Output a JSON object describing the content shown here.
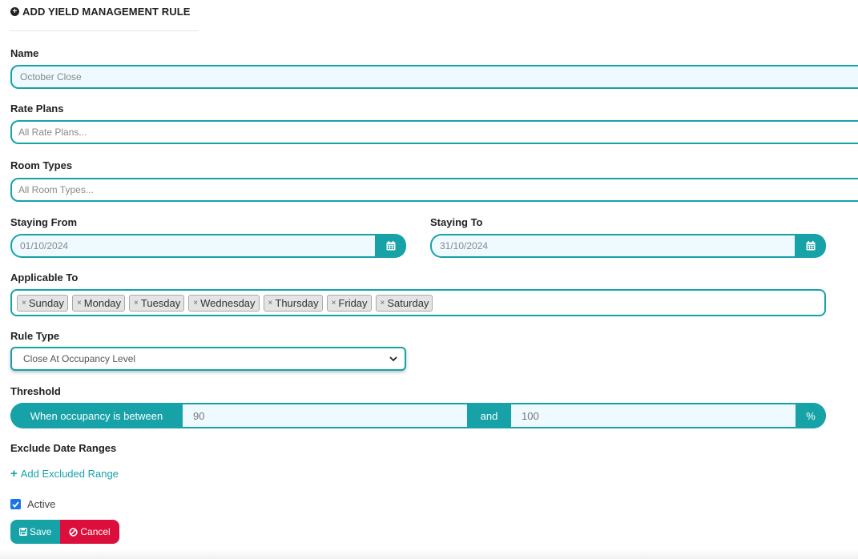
{
  "form": {
    "title": "ADD YIELD MANAGEMENT RULE",
    "title_icon": "plus-circle-icon",
    "name": {
      "label": "Name",
      "value": "October Close"
    },
    "rate_plans": {
      "label": "Rate Plans",
      "placeholder": "All Rate Plans..."
    },
    "room_types": {
      "label": "Room Types",
      "placeholder": "All Room Types..."
    },
    "staying_from": {
      "label": "Staying From",
      "value": "01/10/2024",
      "icon": "calendar-icon"
    },
    "staying_to": {
      "label": "Staying To",
      "value": "31/10/2024",
      "icon": "calendar-icon"
    },
    "applicable_to": {
      "label": "Applicable To",
      "days": [
        "Sunday",
        "Monday",
        "Tuesday",
        "Wednesday",
        "Thursday",
        "Friday",
        "Saturday"
      ],
      "remove_glyph": "×"
    },
    "rule_type": {
      "label": "Rule Type",
      "selected": "Close At Occupancy Level"
    },
    "threshold": {
      "label": "Threshold",
      "prefix": "When occupancy is between",
      "min": "90",
      "joiner": "and",
      "max": "100",
      "suffix": "%"
    },
    "exclude": {
      "label": "Exclude Date Ranges",
      "add_link": "Add Excluded Range"
    },
    "active": {
      "label": "Active",
      "checked": true
    },
    "buttons": {
      "save": "Save",
      "cancel": "Cancel"
    }
  },
  "colors": {
    "accent": "#17a2a8",
    "danger": "#dc0f3c",
    "input_bg": "#eefaff"
  }
}
